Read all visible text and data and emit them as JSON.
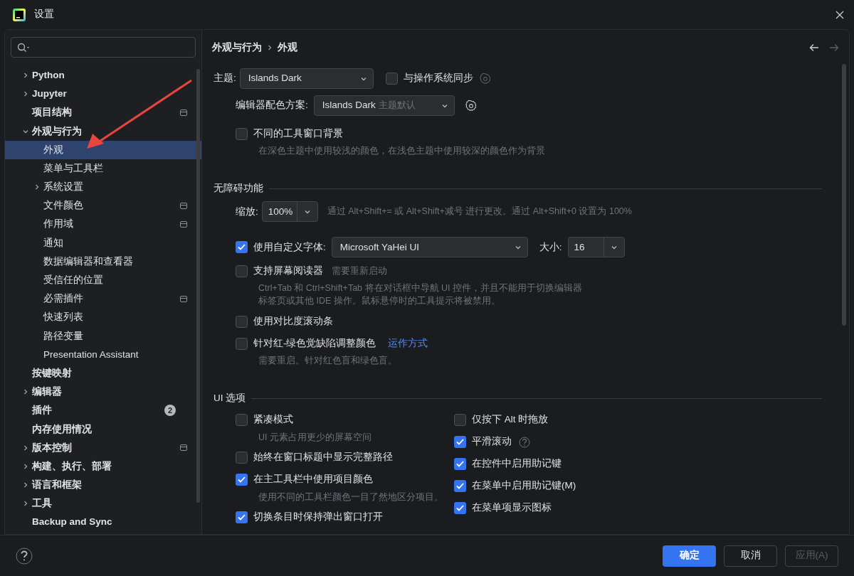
{
  "window": {
    "title": "设置"
  },
  "sidebar": {
    "items": [
      {
        "label": "Python",
        "expanded": false
      },
      {
        "label": "Jupyter",
        "expanded": false
      },
      {
        "label": "项目结构",
        "project_level": true
      },
      {
        "label": "外观与行为",
        "expanded": true,
        "children": [
          {
            "label": "外观",
            "selected": true
          },
          {
            "label": "菜单与工具栏",
            "selected": false
          },
          {
            "label": "系统设置",
            "selected": false,
            "expanded": false
          },
          {
            "label": "文件颜色",
            "selected": false,
            "project_level": true
          },
          {
            "label": "作用域",
            "selected": false,
            "project_level": true
          },
          {
            "label": "通知",
            "selected": false
          },
          {
            "label": "数据编辑器和查看器",
            "selected": false
          },
          {
            "label": "受信任的位置",
            "selected": false
          },
          {
            "label": "必需插件",
            "selected": false,
            "project_level": true
          },
          {
            "label": "快速列表",
            "selected": false
          },
          {
            "label": "路径变量",
            "selected": false
          },
          {
            "label": "Presentation Assistant",
            "selected": false
          }
        ]
      },
      {
        "label": "按键映射"
      },
      {
        "label": "编辑器",
        "expanded": false
      },
      {
        "label": "插件",
        "badge": "2"
      },
      {
        "label": "内存使用情况"
      },
      {
        "label": "版本控制",
        "expanded": false,
        "project_level": true
      },
      {
        "label": "构建、执行、部署",
        "expanded": false
      },
      {
        "label": "语言和框架",
        "expanded": false
      },
      {
        "label": "工具",
        "expanded": false
      },
      {
        "label": "Backup and Sync"
      }
    ]
  },
  "breadcrumb": [
    "外观与行为",
    "外观"
  ],
  "theme": {
    "label": "主题:",
    "value": "Islands Dark",
    "sync": {
      "label": "与操作系统同步",
      "checked": false
    }
  },
  "editor_scheme": {
    "label": "编辑器配色方案:",
    "value": "Islands Dark",
    "hint": "主题默认"
  },
  "tool_window_bg": {
    "label": "不同的工具窗口背景",
    "checked": false,
    "description": [
      "在深色主题中使用较浅的颜色，在浅色主题中使用较深的颜色作为背景"
    ]
  },
  "accessibility": {
    "title": "无障碍功能",
    "zoom": {
      "label": "缩放:",
      "value": "100%",
      "hint": "通过 Alt+Shift+= 或 Alt+Shift+减号 进行更改。通过 Alt+Shift+0 设置为 100%"
    },
    "custom_font": {
      "label": "使用自定义字体:",
      "checked": true,
      "font": "Microsoft YaHei UI",
      "size_label": "大小:",
      "size": "16"
    },
    "options": [
      {
        "label": "支持屏幕阅读器",
        "checked": false,
        "note": "需要重新启动",
        "description": [
          "Ctrl+Tab 和 Ctrl+Shift+Tab 将在对话框中导航 UI 控件，并且不能用于切换编辑器",
          "标签页或其他 IDE 操作。鼠标悬停时的工具提示将被禁用。"
        ]
      },
      {
        "label": "使用对比度滚动条",
        "checked": false
      },
      {
        "label": "针对红-绿色觉缺陷调整颜色",
        "checked": false,
        "link": "运作方式",
        "description": [
          "需要重启。针对红色盲和绿色盲。"
        ]
      }
    ]
  },
  "ui_options": {
    "title": "UI 选项",
    "left": [
      {
        "label": "紧凑模式",
        "checked": false,
        "description": [
          "UI 元素占用更少的屏幕空间"
        ]
      },
      {
        "label": "始终在窗口标题中显示完整路径",
        "checked": false
      },
      {
        "label": "在主工具栏中使用项目颜色",
        "checked": true,
        "description": [
          "使用不同的工具栏颜色一目了然地区分项目。"
        ]
      },
      {
        "label": "切换条目时保持弹出窗口打开",
        "checked": true
      }
    ],
    "right": [
      {
        "label": "仅按下 Alt 时拖放",
        "checked": false
      },
      {
        "label": "平滑滚动",
        "checked": true,
        "help": true
      },
      {
        "label": "在控件中启用助记键",
        "checked": true
      },
      {
        "label": "在菜单中启用助记键(M)",
        "checked": true
      },
      {
        "label": "在菜单项显示图标",
        "checked": true
      }
    ]
  },
  "footer": {
    "buttons": [
      {
        "label": "确定",
        "kind": "primary",
        "disabled": false
      },
      {
        "label": "取消",
        "kind": "secondary",
        "disabled": false
      },
      {
        "label": "应用(A)",
        "kind": "secondary",
        "disabled": true
      }
    ]
  }
}
